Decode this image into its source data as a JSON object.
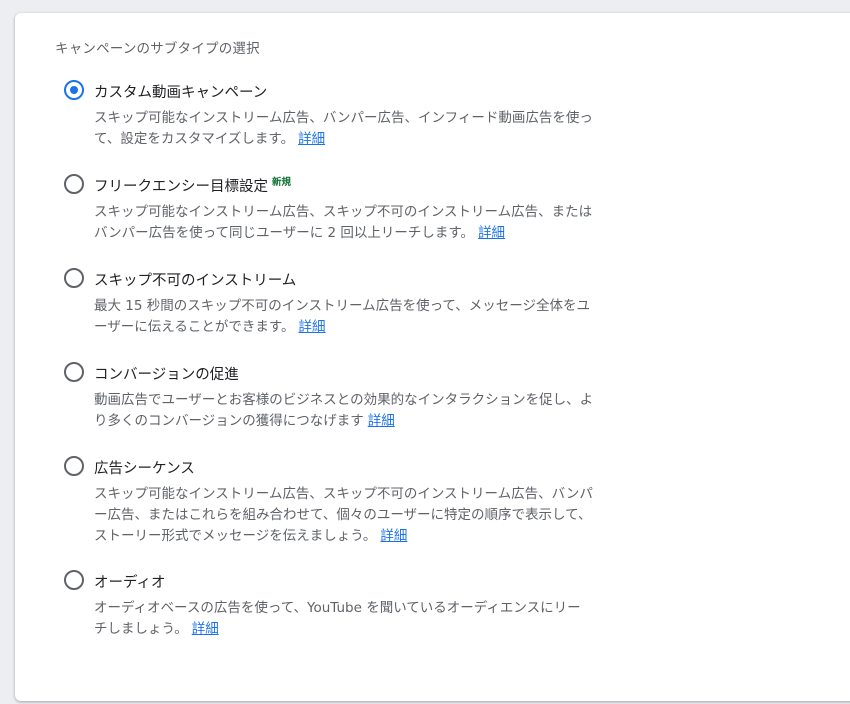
{
  "section_title": "キャンペーンのサブタイプの選択",
  "link_label": "詳細",
  "options": [
    {
      "title": "カスタム動画キャンペーン",
      "badge": "",
      "selected": true,
      "description": "スキップ可能なインストリーム広告、バンパー広告、インフィード動画広告を使って、設定をカスタマイズします。"
    },
    {
      "title": "フリークエンシー目標設定",
      "badge": "新規",
      "selected": false,
      "description": "スキップ可能なインストリーム広告、スキップ不可のインストリーム広告、またはバンパー広告を使って同じユーザーに 2 回以上リーチします。"
    },
    {
      "title": "スキップ不可のインストリーム",
      "badge": "",
      "selected": false,
      "description": "最大 15 秒間のスキップ不可のインストリーム広告を使って、メッセージ全体をユーザーに伝えることができます。"
    },
    {
      "title": "コンバージョンの促進",
      "badge": "",
      "selected": false,
      "description": "動画広告でユーザーとお客様のビジネスとの効果的なインタラクションを促し、より多くのコンバージョンの獲得につなげます"
    },
    {
      "title": "広告シーケンス",
      "badge": "",
      "selected": false,
      "description": "スキップ可能なインストリーム広告、スキップ不可のインストリーム広告、バンパー広告、またはこれらを組み合わせて、個々のユーザーに特定の順序で表示して、ストーリー形式でメッセージを伝えましょう。"
    },
    {
      "title": "オーディオ",
      "badge": "",
      "selected": false,
      "description": "オーディオベースの広告を使って、YouTube を聞いているオーディエンスにリーチしましょう。"
    }
  ],
  "colors": {
    "accent": "#1a73e8",
    "badge": "#137333"
  }
}
